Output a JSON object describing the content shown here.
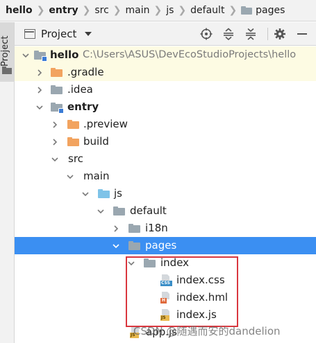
{
  "breadcrumb": {
    "items": [
      {
        "label": "hello",
        "bold": true
      },
      {
        "label": "entry",
        "bold": true
      },
      {
        "label": "src",
        "bold": false
      },
      {
        "label": "main",
        "bold": false
      },
      {
        "label": "js",
        "bold": false
      },
      {
        "label": "default",
        "bold": false
      },
      {
        "label": "pages",
        "bold": false,
        "icon": "folder-icon"
      }
    ]
  },
  "sidebar": {
    "tab_label": "Project"
  },
  "toolbar": {
    "view_label": "Project",
    "buttons": [
      "locate-icon",
      "expand-all-icon",
      "collapse-all-icon",
      "gear-icon",
      "minimize-icon"
    ]
  },
  "tree": {
    "rows": [
      {
        "name": "hello",
        "bold": true,
        "hint": "C:\\Users\\ASUS\\DevEcoStudioProjects\\hello",
        "expanded": true,
        "icon": "module-folder-icon",
        "color": "#9aa7b0",
        "highlight": true
      },
      {
        "name": ".gradle",
        "expanded": false,
        "icon": "folder-icon",
        "color": "#f2a35f",
        "highlight": true
      },
      {
        "name": ".idea",
        "expanded": false,
        "icon": "folder-icon",
        "color": "#9aa7b0"
      },
      {
        "name": "entry",
        "bold": true,
        "expanded": true,
        "icon": "module-folder-icon",
        "color": "#9aa7b0"
      },
      {
        "name": ".preview",
        "expanded": false,
        "icon": "folder-icon",
        "color": "#f2a35f"
      },
      {
        "name": "build",
        "expanded": false,
        "icon": "folder-icon",
        "color": "#f2a35f"
      },
      {
        "name": "src",
        "expanded": true,
        "icon": "none"
      },
      {
        "name": "main",
        "expanded": true,
        "icon": "none"
      },
      {
        "name": "js",
        "expanded": true,
        "icon": "folder-icon",
        "color": "#7ec3e8"
      },
      {
        "name": "default",
        "expanded": true,
        "icon": "folder-icon",
        "color": "#9aa7b0"
      },
      {
        "name": "i18n",
        "expanded": false,
        "icon": "folder-icon",
        "color": "#9aa7b0"
      },
      {
        "name": "pages",
        "expanded": true,
        "icon": "folder-icon",
        "color": "#9aa7b0",
        "selected": true
      },
      {
        "name": "index",
        "expanded": true,
        "icon": "folder-icon",
        "color": "#9aa7b0"
      },
      {
        "name": "index.css",
        "icon": "css-file-icon",
        "tag": "CSS"
      },
      {
        "name": "index.hml",
        "icon": "hml-file-icon",
        "tag": "H"
      },
      {
        "name": "index.js",
        "icon": "js-file-icon",
        "tag": "JS"
      },
      {
        "name": "app.js",
        "icon": "js-file-icon",
        "tag": "JS"
      }
    ]
  },
  "watermark": {
    "text": "CSDN @随遇而安的dandelion"
  },
  "colors": {
    "selection": "#3b8ff2",
    "highlight": "#fdfbe3",
    "annotation_box": "#d9363e"
  }
}
